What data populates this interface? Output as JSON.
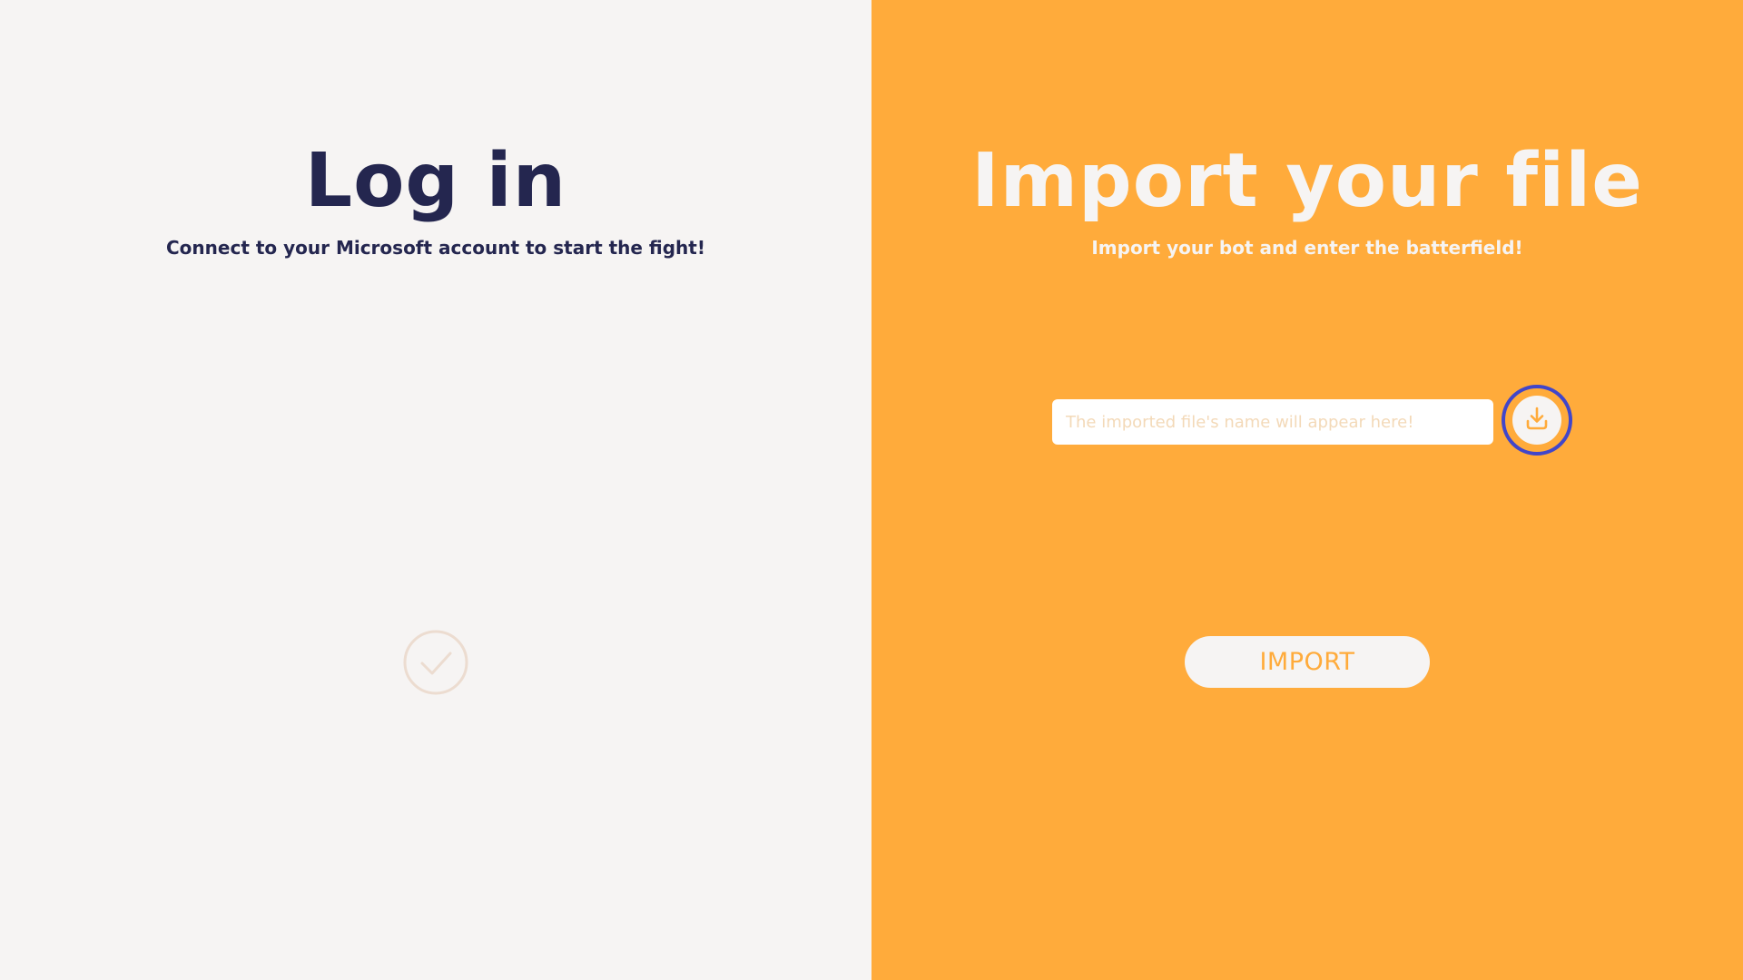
{
  "colors": {
    "left_background": "#f6f4f3",
    "right_background": "#ffab3b",
    "title_dark": "#24264f",
    "title_light": "#f6f4f3",
    "focus_ring": "#4146c9",
    "checkmark": "#ecdcd0"
  },
  "login": {
    "title": "Log in",
    "subtitle": "Connect to your Microsoft account to start the fight!",
    "status_icon": "check-circle-icon"
  },
  "import": {
    "title": "Import your file",
    "subtitle": "Import your bot and enter the batterfield!",
    "file_input": {
      "value": "",
      "placeholder": "The imported file's name will appear here!"
    },
    "browse_icon": "download-icon",
    "button_label": "IMPORT"
  }
}
